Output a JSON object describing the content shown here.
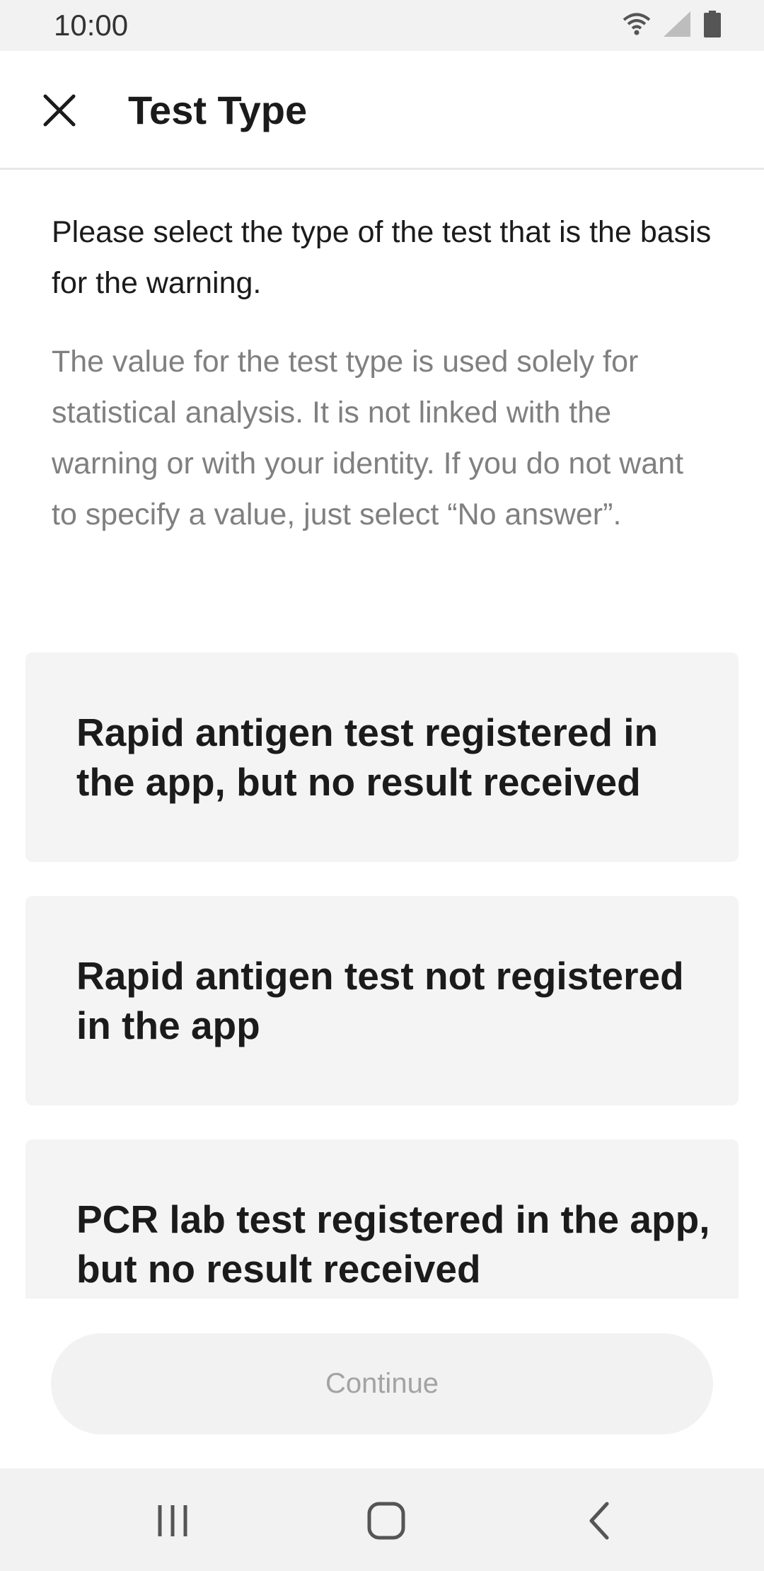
{
  "status_bar": {
    "time": "10:00",
    "icons": [
      "wifi-icon",
      "signal-icon",
      "battery-icon"
    ]
  },
  "header": {
    "title": "Test Type",
    "close_icon": "close-icon"
  },
  "main": {
    "intro": "Please select the type of the test that is the basis for the warning.",
    "note": "The value for the test type is used solely for statistical analysis. It is not linked with the warning or with your identity. If you do not want to specify a value, just select “No answer”.",
    "options": [
      {
        "label": "Rapid antigen test registered in the app, but no result received"
      },
      {
        "label": "Rapid antigen test not registered in the app"
      },
      {
        "label": "PCR lab test registered in the app, but no result received"
      }
    ]
  },
  "footer": {
    "continue_label": "Continue"
  },
  "nav_bar": {
    "icons": [
      "recent-apps-icon",
      "home-icon",
      "back-icon"
    ]
  },
  "colors": {
    "option_background": "#f4f4f4",
    "note_text": "#808080",
    "button_disabled_text": "#a3a3a3"
  }
}
